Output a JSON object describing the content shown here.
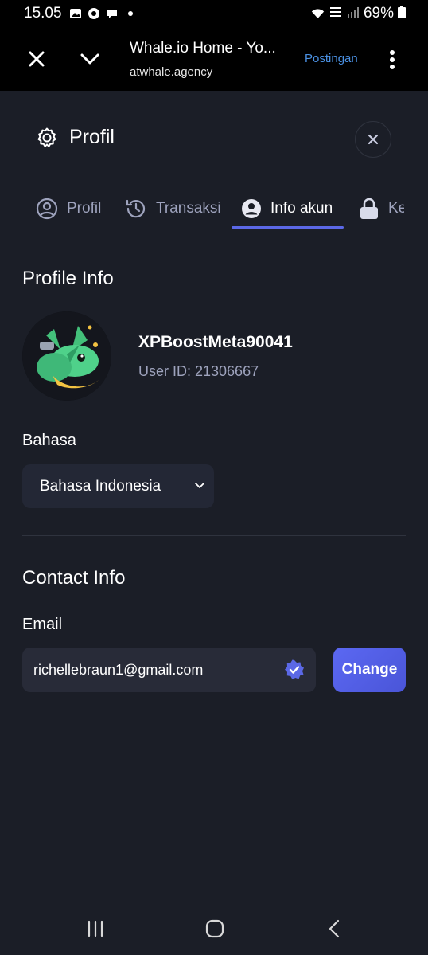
{
  "status_bar": {
    "time": "15.05",
    "battery": "69%"
  },
  "browser": {
    "title": "Whale.io Home - Yo...",
    "url": "atwhale.agency",
    "action": "Postingan"
  },
  "modal": {
    "title": "Profil"
  },
  "tabs": [
    {
      "label": "Profil"
    },
    {
      "label": "Transaksi"
    },
    {
      "label": "Info akun"
    },
    {
      "label": "Ke"
    }
  ],
  "profile_info": {
    "title": "Profile Info",
    "username": "XPBoostMeta90041",
    "user_id": "User ID: 21306667"
  },
  "language": {
    "label": "Bahasa",
    "selected": "Bahasa Indonesia"
  },
  "contact_info": {
    "title": "Contact Info",
    "email_label": "Email",
    "email_value": "richellebraun1@gmail.com",
    "change_label": "Change"
  },
  "colors": {
    "background": "#1b1e27",
    "accent": "#5b68e6",
    "muted_text": "#9ea3bd",
    "input_bg": "#282b38"
  }
}
